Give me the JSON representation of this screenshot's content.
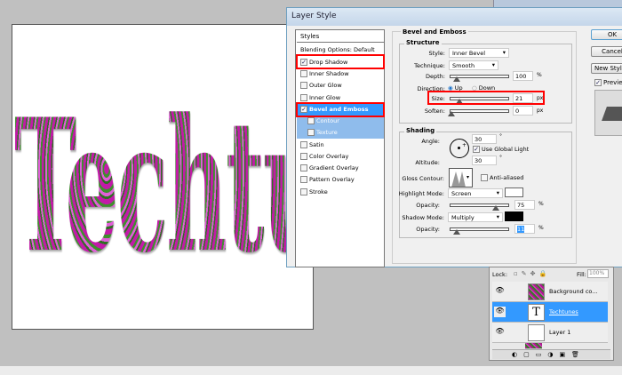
{
  "canvas": {
    "text": "Techtu"
  },
  "dialog": {
    "title": "Layer Style",
    "styles_header": "Styles",
    "styles": [
      {
        "label": "Blending Options: Default",
        "checked": null
      },
      {
        "label": "Drop Shadow",
        "checked": true
      },
      {
        "label": "Inner Shadow",
        "checked": false
      },
      {
        "label": "Outer Glow",
        "checked": false
      },
      {
        "label": "Inner Glow",
        "checked": false
      },
      {
        "label": "Bevel and Emboss",
        "checked": true
      },
      {
        "label": "Contour",
        "checked": false
      },
      {
        "label": "Texture",
        "checked": false
      },
      {
        "label": "Satin",
        "checked": false
      },
      {
        "label": "Color Overlay",
        "checked": false
      },
      {
        "label": "Gradient Overlay",
        "checked": false
      },
      {
        "label": "Pattern Overlay",
        "checked": false
      },
      {
        "label": "Stroke",
        "checked": false
      }
    ],
    "section_title": "Bevel and Emboss",
    "structure": {
      "title": "Structure",
      "style_label": "Style:",
      "style": "Inner Bevel",
      "technique_label": "Technique:",
      "technique": "Smooth",
      "depth_label": "Depth:",
      "depth": "100",
      "depth_unit": "%",
      "direction_label": "Direction:",
      "dir_up": "Up",
      "dir_down": "Down",
      "size_label": "Size:",
      "size": "21",
      "size_unit": "px",
      "soften_label": "Soften:",
      "soften": "0",
      "soften_unit": "px"
    },
    "shading": {
      "title": "Shading",
      "angle_label": "Angle:",
      "angle": "30",
      "deg": "°",
      "global_light": "Use Global Light",
      "altitude_label": "Altitude:",
      "altitude": "30",
      "gloss_label": "Gloss Contour:",
      "anti_aliased": "Anti-aliased",
      "highlight_label": "Highlight Mode:",
      "highlight_mode": "Screen",
      "highlight_color": "#ffffff",
      "opacity_label": "Opacity:",
      "highlight_opacity": "75",
      "pct": "%",
      "shadow_label": "Shadow Mode:",
      "shadow_mode": "Multiply",
      "shadow_color": "#000000",
      "shadow_opacity": "11"
    },
    "buttons": {
      "ok": "OK",
      "cancel": "Cancel",
      "new_style": "New Style...",
      "preview": "Preview"
    }
  },
  "layers": {
    "lock_label": "Lock:",
    "fill_label": "Fill:",
    "fill": "100%",
    "items": [
      {
        "name": "Background co..."
      },
      {
        "name": "Techtunes"
      },
      {
        "name": "Layer 1"
      }
    ]
  }
}
